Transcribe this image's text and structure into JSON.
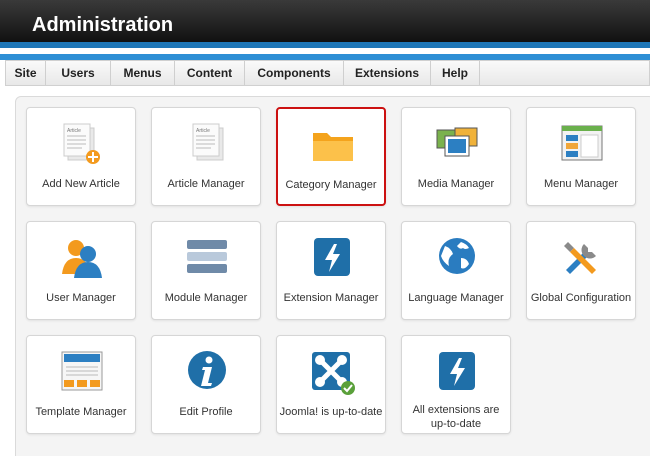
{
  "header": {
    "title": "Administration"
  },
  "menu": {
    "items": [
      "Site",
      "Users",
      "Menus",
      "Content",
      "Components",
      "Extensions",
      "Help"
    ]
  },
  "colors": {
    "accent": "#1e77b8",
    "selected_border": "#cc1111"
  },
  "tiles": [
    {
      "label": "Add New Article",
      "icon": "add-article-icon"
    },
    {
      "label": "Article Manager",
      "icon": "article-icon"
    },
    {
      "label": "Category Manager",
      "icon": "folder-icon",
      "selected": true
    },
    {
      "label": "Media Manager",
      "icon": "media-icon"
    },
    {
      "label": "Menu Manager",
      "icon": "menu-window-icon"
    },
    {
      "label": "User Manager",
      "icon": "users-icon"
    },
    {
      "label": "Module Manager",
      "icon": "module-stack-icon"
    },
    {
      "label": "Extension Manager",
      "icon": "lightning-icon"
    },
    {
      "label": "Language Manager",
      "icon": "globe-icon"
    },
    {
      "label": "Global Configuration",
      "icon": "tools-icon"
    },
    {
      "label": "Template Manager",
      "icon": "template-icon"
    },
    {
      "label": "Edit Profile",
      "icon": "info-icon"
    },
    {
      "label": "Joomla! is up-to-date",
      "icon": "joomla-check-icon"
    },
    {
      "label": "All extensions are up-to-date",
      "icon": "lightning-icon"
    }
  ]
}
